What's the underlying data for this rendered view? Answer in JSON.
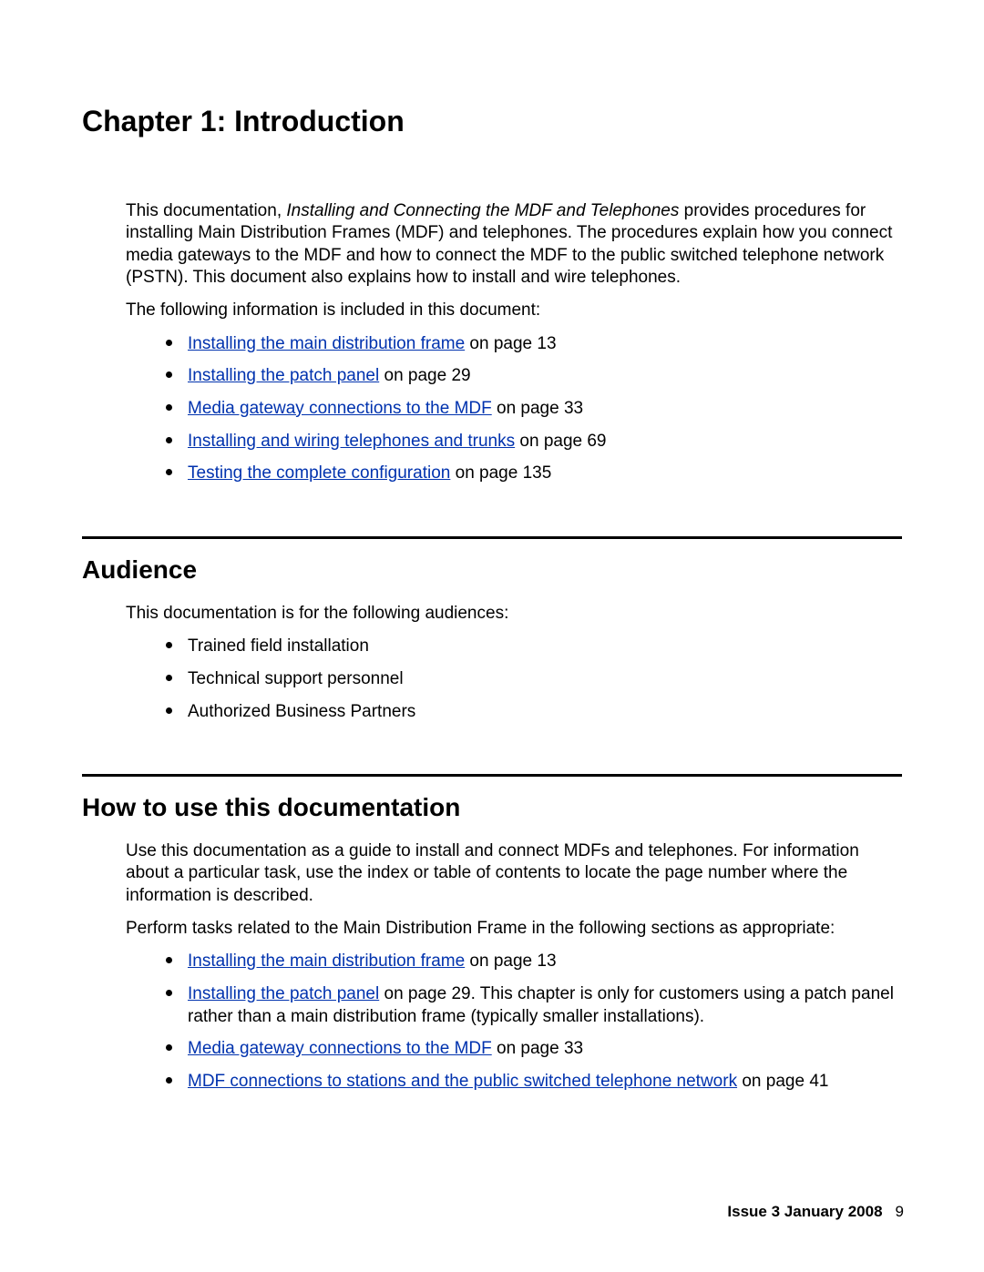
{
  "chapter": {
    "title": "Chapter 1:   Introduction"
  },
  "intro": {
    "p1_prefix": "This documentation, ",
    "p1_italic": "Installing and Connecting the MDF and Telephones",
    "p1_suffix": " provides procedures for installing Main Distribution Frames (MDF) and telephones. The procedures explain how you connect media gateways to the MDF and how to connect the MDF to the public switched telephone network (PSTN). This document also explains how to install and wire telephones.",
    "p2": "The following information is included in this document:"
  },
  "toc_links": [
    {
      "link": "Installing the main distribution frame",
      "suffix": " on page 13"
    },
    {
      "link": "Installing the patch panel",
      "suffix": " on page 29"
    },
    {
      "link": "Media gateway connections to the MDF",
      "suffix": " on page 33"
    },
    {
      "link": "Installing and wiring telephones and trunks",
      "suffix": " on page 69"
    },
    {
      "link": "Testing the complete configuration",
      "suffix": " on page 135"
    }
  ],
  "audience": {
    "heading": "Audience",
    "intro": "This documentation is for the following audiences:",
    "items": [
      "Trained field installation",
      "Technical support personnel",
      "Authorized Business Partners"
    ]
  },
  "howto": {
    "heading": "How to use this documentation",
    "p1": "Use this documentation as a guide to install and connect MDFs and telephones. For information about a particular task, use the index or table of contents to locate the page number where the information is described.",
    "p2": "Perform tasks related to the Main Distribution Frame in the following sections as appropriate:",
    "items": [
      {
        "link": "Installing the main distribution frame",
        "suffix": " on page 13"
      },
      {
        "link": "Installing the patch panel",
        "suffix": " on page 29. This chapter is only for customers using a patch panel rather than a main distribution frame (typically smaller installations)."
      },
      {
        "link": "Media gateway connections to the MDF",
        "suffix": " on page 33"
      },
      {
        "link": "MDF connections to stations and the public switched telephone network",
        "suffix": " on page 41"
      }
    ]
  },
  "footer": {
    "issue": "Issue 3   January 2008",
    "page": "9"
  }
}
